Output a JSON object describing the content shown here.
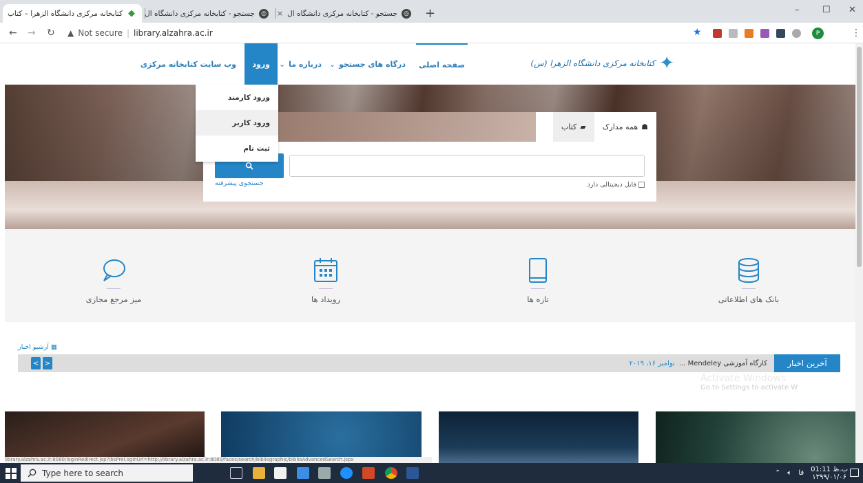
{
  "browser": {
    "tabs": [
      {
        "title": "کتابخانه مرکزی دانشگاه الزهرا – کتاب",
        "active": true
      },
      {
        "title": "جستجو - کتابخانه مرکزی دانشگاه ال",
        "active": false
      },
      {
        "title": "جستجو - کتابخانه مرکزی دانشگاه ال",
        "active": false
      }
    ],
    "new_tab": "+",
    "close": "×",
    "address": {
      "security": "Not secure",
      "url": "library.alzahra.ac.ir"
    },
    "window_controls": {
      "minimize": "–",
      "maximize": "☐",
      "close": "✕"
    },
    "profile_initial": "P"
  },
  "site": {
    "logo_text": "کتابخانه مرکزی دانشگاه الزهرا (س)",
    "nav": {
      "home": "صفحه اصلی",
      "search_portals": "درگاه های جستجو",
      "about": "درباره ما",
      "login": "ورود",
      "central_site": "وب سایت کتابخانه مرکزی"
    },
    "login_menu": [
      "ورود کارمند",
      "ورود کاربر",
      "ثبت نام"
    ],
    "search": {
      "tab_all": "همه مدارک",
      "tab_book": "کتاب",
      "input_value": "",
      "digital_file": "فایل دیجیتالی دارد",
      "advanced": "جستجوی پیشرفته"
    },
    "features": [
      {
        "label": "بانک های اطلاعاتی",
        "icon": "database-icon"
      },
      {
        "label": "تازه ها",
        "icon": "book-icon"
      },
      {
        "label": "رویداد ها",
        "icon": "calendar-icon"
      },
      {
        "label": "میز مرجع مجازی",
        "icon": "chat-icon"
      }
    ],
    "news": {
      "archive": "آرشیو اخبار",
      "label": "آخرین اخبار",
      "item": "کارگاه آموزشی Mendeley ...",
      "date": "نوامبر ۱۶، ۲۰۱۹",
      "prev": "<",
      "next": ">"
    }
  },
  "status_url": "library.alzahra.ac.ir:8080/loginRedirect.jsp?ibsPrel.oginUrl=http://library.alzahra.ac.ir:8080/faces/search/bibliographic/biblioAdvancedSearch.jspx",
  "watermark": {
    "title": "Activate Windows",
    "subtitle": "Go to Settings to activate W"
  },
  "taskbar": {
    "search_placeholder": "Type here to search",
    "time": "01:11 ب.ظ",
    "date": "۱۳۹۹/۰۱/۰۶",
    "lang": "فا"
  },
  "colors": {
    "accent": "#2586c7",
    "taskbar": "#1f2c3e"
  }
}
